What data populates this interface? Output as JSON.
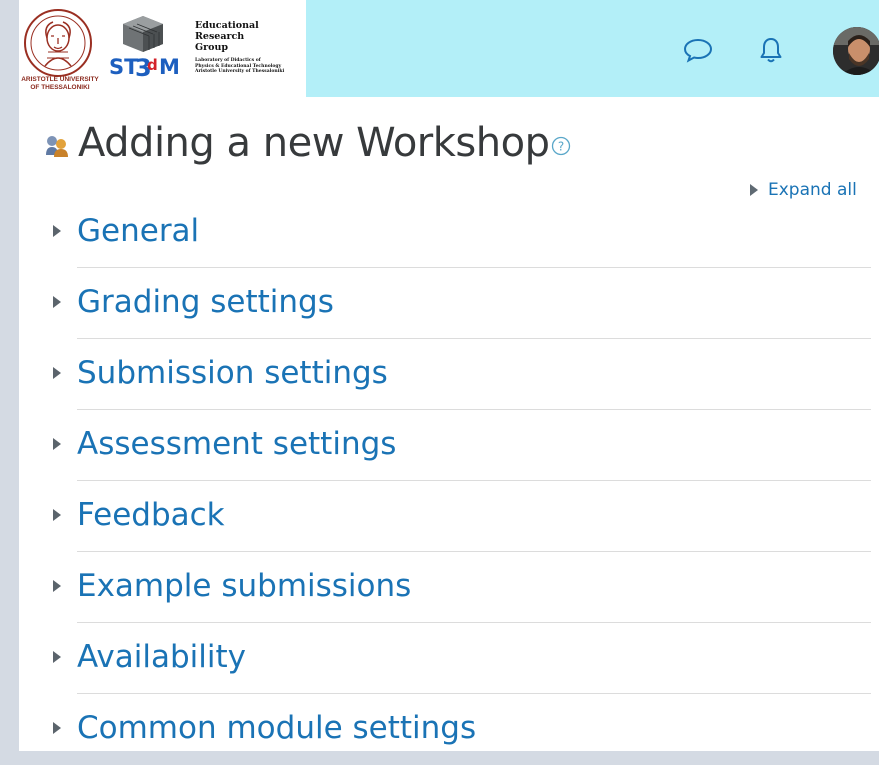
{
  "header": {
    "university_caption": "ARISTOTLE UNIVERSITY\nOF THESSALONIKI",
    "st3dm_text": "ST3dM",
    "group_title": "Educational\nResearch\nGroup",
    "group_subtitle": "Laboratory of Didactics of\nPhysics & Educational Technology\nAristotle University of Thessaloniki",
    "nav_bg_color": "#b3eff8",
    "icons": [
      "message-icon",
      "bell-icon",
      "avatar"
    ]
  },
  "page": {
    "title": "Adding a new Workshop",
    "expand_all_label": "Expand all"
  },
  "sections": [
    {
      "label": "General"
    },
    {
      "label": "Grading settings"
    },
    {
      "label": "Submission settings"
    },
    {
      "label": "Assessment settings"
    },
    {
      "label": "Feedback"
    },
    {
      "label": "Example submissions"
    },
    {
      "label": "Availability"
    },
    {
      "label": "Common module settings"
    }
  ],
  "colors": {
    "link": "#1a73b5",
    "title": "#373a3c",
    "side_background": "#d4dae3"
  }
}
